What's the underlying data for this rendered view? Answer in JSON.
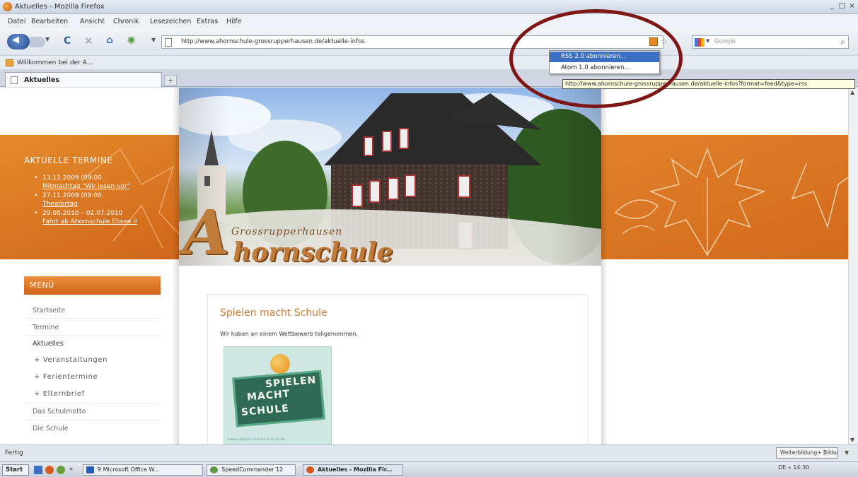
{
  "window": {
    "title": "Aktuelles - Mozilla Firefox",
    "controls": [
      "_",
      "□",
      "×"
    ]
  },
  "menubar": [
    "Datei",
    "Bearbeiten",
    "Ansicht",
    "Chronik",
    "Lesezeichen",
    "Extras",
    "Hilfe"
  ],
  "navbar": {
    "url": "http://www.ahornschule-grossrupperhausen.de/aktuelle-infos",
    "search_placeholder": "Google"
  },
  "feed_menu": {
    "items": [
      "RSS 2.0 abonnieren...",
      "Atom 1.0 abonnieren..."
    ],
    "tooltip": "http://www.ahornschule-grossrupperhausen.de/aktuelle-infos?format=feed&type=rss"
  },
  "bookmarks": [
    "Willkommen bei der A..."
  ],
  "tab": {
    "label": "Aktuelles",
    "new_tab": "+"
  },
  "termine": {
    "title": "AKTUELLE TERMINE",
    "items": [
      {
        "date": "13.11.2009 (09:00",
        "link": "Mitmachtag \"Wir lesen vor\""
      },
      {
        "date": "27.11.2009 (09:00",
        "link": "Theatertag"
      },
      {
        "date": "29.06.2010 – 02.07.2010",
        "link": "Fahrt ab Ahornschule Ebsee II"
      }
    ]
  },
  "hero": {
    "subtitle": "Grossrupperhausen",
    "logo_initial": "A",
    "logo_rest": "hornschule"
  },
  "menu": {
    "header": "MENÜ",
    "items": [
      {
        "label": "Startseite",
        "type": "item"
      },
      {
        "label": "Termine",
        "type": "item"
      },
      {
        "label": "Aktuelles",
        "type": "active"
      },
      {
        "label": "+ Veranstaltungen",
        "type": "sub"
      },
      {
        "label": "+ Ferientermine",
        "type": "sub"
      },
      {
        "label": "+ Elternbrief",
        "type": "sub"
      },
      {
        "label": "Das Schulmotto",
        "type": "item"
      },
      {
        "label": "Die Schule",
        "type": "item"
      }
    ]
  },
  "article": {
    "title": "Spielen macht Schule",
    "text": "Wir haben an einem Wettbewerb teilgenommen.",
    "image": {
      "line1": "SPIELEN",
      "line2": "MACHT",
      "line3": "SCHULE",
      "url": "www.spielen-macht-schule.de"
    }
  },
  "statusbar": {
    "status": "Fertig",
    "addon": "Weiterbildung+ Bildungsanbieter"
  },
  "taskbar": {
    "start": "Start",
    "buttons": [
      "9 Microsoft Office W...",
      "SpeedCommander 12",
      "Aktuelles - Mozilla Fir..."
    ],
    "tray": "DE  «  14:30"
  },
  "colors": {
    "accent_orange": "#d87223",
    "link_blue": "#3b6fc1",
    "annotation_red": "#7e1616"
  }
}
